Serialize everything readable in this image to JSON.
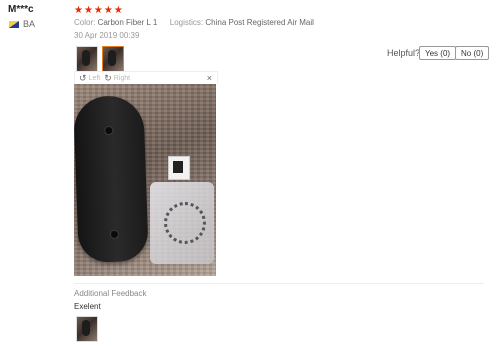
{
  "review": {
    "username": "M***c",
    "country_code": "BA",
    "rating_stars": "★★★★★",
    "rating": 5,
    "color_label": "Color:",
    "color_value": "Carbon Fiber L 1",
    "logistics_label": "Logistics:",
    "logistics_value": "China Post Registered Air Mail",
    "date": "30 Apr 2019 00:39"
  },
  "helpful": {
    "label": "Helpful?",
    "yes": "Yes (0)",
    "no": "No (0)"
  },
  "viewer": {
    "rotate_left": "Left",
    "rotate_right": "Right",
    "close": "×"
  },
  "additional": {
    "heading": "Additional Feedback",
    "text": "Exelent"
  },
  "colors": {
    "star": "#e62e04",
    "selected_thumb_border": "#e67e22"
  }
}
